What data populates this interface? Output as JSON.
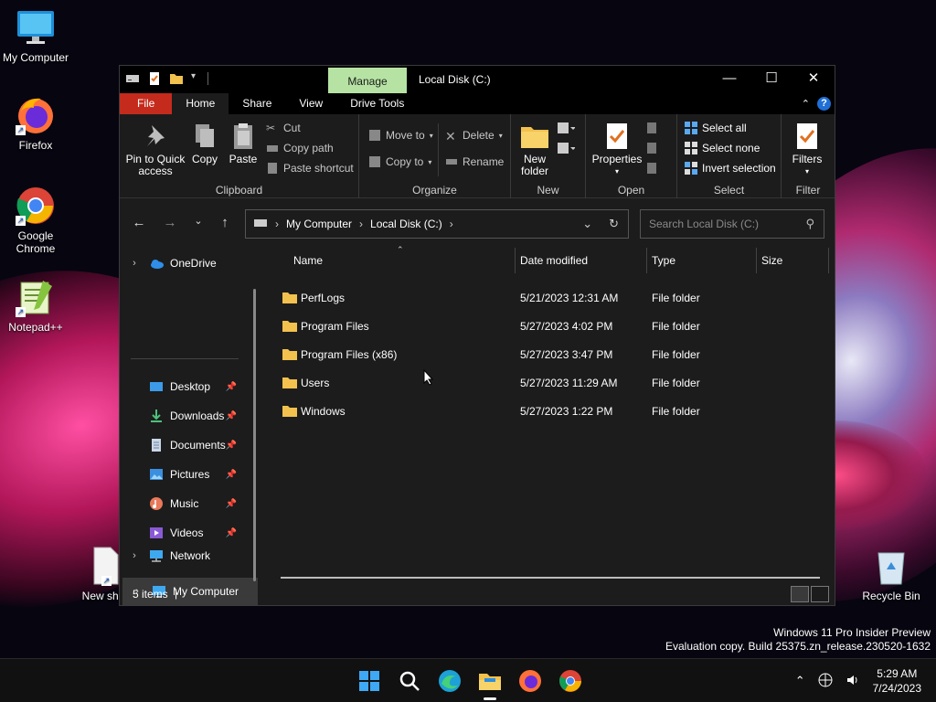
{
  "desktop": {
    "icons": [
      {
        "label": "My Computer"
      },
      {
        "label": "Firefox"
      },
      {
        "label": "Google Chrome"
      },
      {
        "label": "Notepad++"
      },
      {
        "label": "New shor"
      },
      {
        "label": "Recycle Bin"
      }
    ],
    "watermark": {
      "line1": "Windows 11 Pro Insider Preview",
      "line2": "Evaluation copy. Build 25375.zn_release.230520-1632"
    }
  },
  "window": {
    "title": "Local Disk (C:)",
    "context_tab": "Manage",
    "controls": {
      "minimize": "—",
      "maximize": "☐",
      "close": "✕"
    },
    "tabs": [
      {
        "label": "File"
      },
      {
        "label": "Home"
      },
      {
        "label": "Share"
      },
      {
        "label": "View"
      },
      {
        "label": "Drive Tools"
      }
    ],
    "ribbon": {
      "clipboard": {
        "label": "Clipboard",
        "pin": "Pin to Quick access",
        "pin_line1": "Pin to Quick",
        "pin_line2": "access",
        "copy": "Copy",
        "paste": "Paste",
        "cut": "Cut",
        "copy_path": "Copy path",
        "paste_shortcut": "Paste shortcut"
      },
      "organize": {
        "label": "Organize",
        "move_to": "Move to",
        "copy_to": "Copy to",
        "delete": "Delete",
        "rename": "Rename"
      },
      "new": {
        "label": "New",
        "new_folder_line1": "New",
        "new_folder_line2": "folder"
      },
      "open": {
        "label": "Open",
        "properties": "Properties"
      },
      "select": {
        "label": "Select",
        "select_all": "Select all",
        "select_none": "Select none",
        "invert": "Invert selection"
      },
      "filter": {
        "label": "Filter",
        "filters": "Filters"
      }
    },
    "address": {
      "crumbs": [
        "My Computer",
        "Local Disk (C:)"
      ],
      "search_placeholder": "Search Local Disk (C:)"
    },
    "nav": {
      "onedrive": "OneDrive",
      "quick": [
        {
          "label": "Desktop"
        },
        {
          "label": "Downloads"
        },
        {
          "label": "Documents"
        },
        {
          "label": "Pictures"
        },
        {
          "label": "Music"
        },
        {
          "label": "Videos"
        }
      ],
      "my_computer": "My Computer",
      "network": "Network"
    },
    "columns": [
      "Name",
      "Date modified",
      "Type",
      "Size"
    ],
    "files": [
      {
        "name": "PerfLogs",
        "date": "5/21/2023 12:31 AM",
        "type": "File folder"
      },
      {
        "name": "Program Files",
        "date": "5/27/2023 4:02 PM",
        "type": "File folder"
      },
      {
        "name": "Program Files (x86)",
        "date": "5/27/2023 3:47 PM",
        "type": "File folder"
      },
      {
        "name": "Users",
        "date": "5/27/2023 11:29 AM",
        "type": "File folder"
      },
      {
        "name": "Windows",
        "date": "5/27/2023 1:22 PM",
        "type": "File folder"
      }
    ],
    "status": {
      "count": "5 items"
    }
  },
  "taskbar": {
    "apps": [
      "start-icon",
      "search-icon",
      "edge-icon",
      "file-explorer-icon",
      "firefox-icon",
      "chrome-icon"
    ],
    "time": "5:29 AM",
    "date": "7/24/2023"
  },
  "colors": {
    "file_tab": "#c42b1c",
    "manage_tab": "#b6e3a3",
    "accent": "#1f6fd6",
    "folder": "#f2c14e"
  }
}
